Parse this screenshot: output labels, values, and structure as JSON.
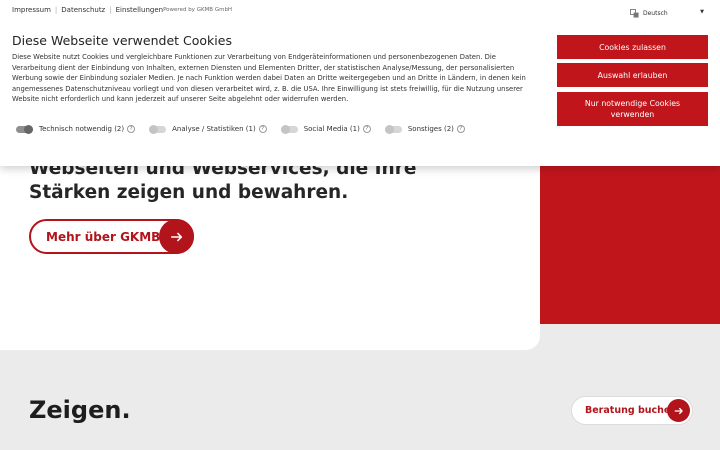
{
  "colors": {
    "brand_red": "#c0161b",
    "button_red": "#b1141a",
    "page_bg": "#ebebeb"
  },
  "topnav": {
    "links": [
      "Impressum",
      "Datenschutz",
      "Einstellungen"
    ],
    "powered_by": "Powered by GKMB GmbH"
  },
  "language": {
    "selected": "Deutsch",
    "icon": "translate-icon"
  },
  "cookie": {
    "title": "Diese Webseite verwendet Cookies",
    "text": "Diese Website nutzt Cookies und vergleichbare Funktionen zur Verarbeitung von Endgeräteinformationen und personenbezogenen Daten. Die Verarbeitung dient der Einbindung von Inhalten, externen Diensten und Elementen Dritter, der statistischen Analyse/Messung, der personalisierten Werbung sowie der Einbindung sozialer Medien. Je nach Funktion werden dabei Daten an Dritte weitergegeben und an Dritte in Ländern, in denen kein angemessenes Datenschutzniveau vorliegt und von diesen verarbeitet wird, z. B. die USA. Ihre Einwilligung ist stets freiwillig, für die Nutzung unserer Website nicht erforderlich und kann jederzeit auf unserer Seite abgelehnt oder widerrufen werden.",
    "toggles": [
      {
        "label": "Technisch notwendig (2)",
        "on": true
      },
      {
        "label": "Analyse / Statistiken (1)",
        "on": false
      },
      {
        "label": "Social Media (1)",
        "on": false
      },
      {
        "label": "Sonstiges (2)",
        "on": false
      }
    ],
    "buttons": {
      "accept": "Cookies zulassen",
      "select": "Auswahl erlauben",
      "necessary": "Nur notwendige Cookies verwenden"
    },
    "help_glyph": "?"
  },
  "hero": {
    "heading_lines": [
      "Webseiten und Webservices, die Ihre",
      "Stärken zeigen und bewahren."
    ],
    "more_button": "Mehr über GKMB"
  },
  "section": {
    "heading": "Zeigen.",
    "booking_button": "Beratung buchen"
  }
}
